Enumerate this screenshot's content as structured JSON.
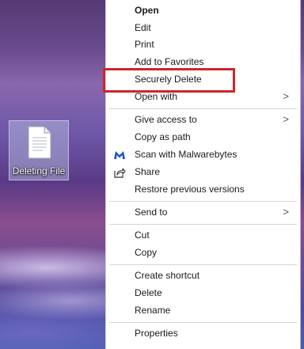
{
  "desktop": {
    "file_icon": {
      "name": "document-icon",
      "label": "Deleting File"
    }
  },
  "context_menu": {
    "items": [
      {
        "label": "Open",
        "bold": true
      },
      {
        "label": "Edit"
      },
      {
        "label": "Print"
      },
      {
        "label": "Add to Favorites"
      },
      {
        "label": "Securely Delete"
      },
      {
        "label": "Open with",
        "submenu": true
      },
      {
        "label": "Give access to",
        "submenu": true
      },
      {
        "label": "Copy as path"
      },
      {
        "label": "Scan with Malwarebytes",
        "icon": "malwarebytes-icon"
      },
      {
        "label": "Share",
        "icon": "share-icon"
      },
      {
        "label": "Restore previous versions"
      },
      {
        "label": "Send to",
        "submenu": true
      },
      {
        "label": "Cut"
      },
      {
        "label": "Copy"
      },
      {
        "label": "Create shortcut"
      },
      {
        "label": "Delete"
      },
      {
        "label": "Rename"
      },
      {
        "label": "Properties"
      }
    ],
    "submenu_glyph": ">"
  },
  "annotation": {
    "highlighted_item": "Securely Delete",
    "color": "#d0242b"
  },
  "colors": {
    "menu_bg": "#ffffff",
    "menu_text": "#1a1a1a",
    "highlight": "#d0242b"
  }
}
